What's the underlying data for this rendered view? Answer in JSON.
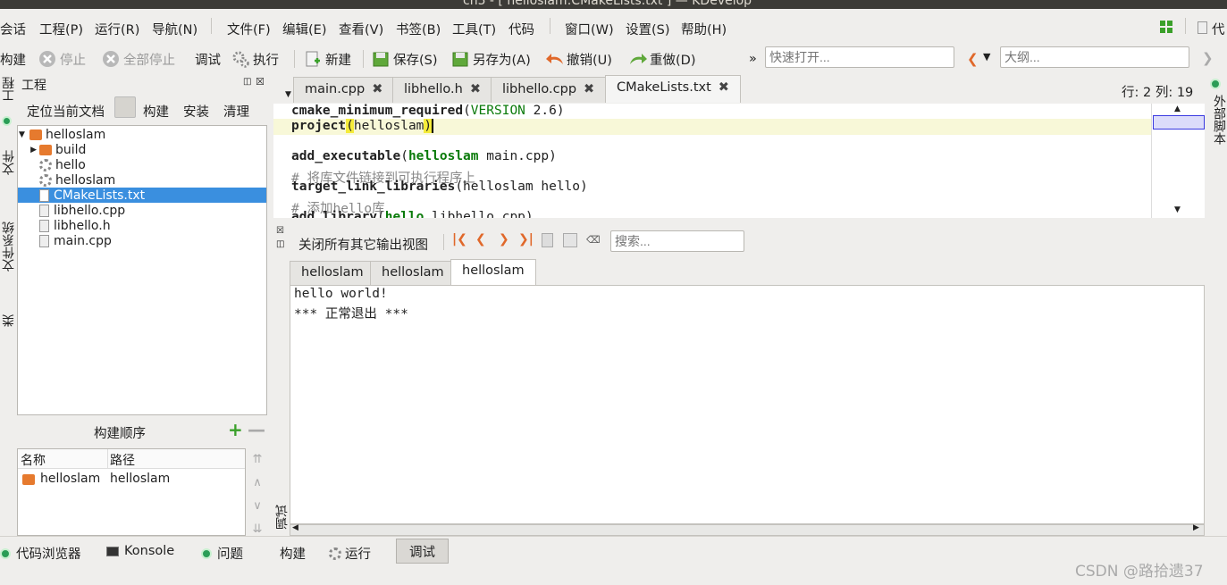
{
  "window": {
    "title": "ch5 - [ helloslam:CMakeLists.txt ] — KDevelop"
  },
  "menubar": {
    "items": [
      "会话",
      "工程(P)",
      "运行(R)",
      "导航(N)",
      "文件(F)",
      "编辑(E)",
      "查看(V)",
      "书签(B)",
      "工具(T)",
      "代码",
      "窗口(W)",
      "设置(S)",
      "帮助(H)"
    ],
    "right_label": "代"
  },
  "toolbar": {
    "build": "构建",
    "stop": "停止",
    "stop_all": "全部停止",
    "debug": "调试",
    "execute": "执行",
    "new": "新建",
    "save": "保存(S)",
    "save_as": "另存为(A)",
    "undo": "撤销(U)",
    "redo": "重做(D)",
    "more": "»",
    "quick_open_placeholder": "快速打开...",
    "outline_placeholder": "大纲..."
  },
  "left_tabs": [
    "工程",
    "文件",
    "文件系统",
    "类"
  ],
  "project_panel": {
    "title": "工程",
    "buttons": [
      "定位当前文档",
      "构建",
      "安装",
      "清理"
    ],
    "tree": [
      {
        "label": "helloslam",
        "icon": "folder-icon",
        "depth": 0
      },
      {
        "label": "build",
        "icon": "folder-icon",
        "depth": 1
      },
      {
        "label": "hello",
        "icon": "gear-icon",
        "depth": 1
      },
      {
        "label": "helloslam",
        "icon": "gear-icon",
        "depth": 1
      },
      {
        "label": "CMakeLists.txt",
        "icon": "file-icon",
        "depth": 1,
        "selected": true
      },
      {
        "label": "libhello.cpp",
        "icon": "file-icon",
        "depth": 1
      },
      {
        "label": "libhello.h",
        "icon": "file-icon",
        "depth": 1
      },
      {
        "label": "main.cpp",
        "icon": "file-icon",
        "depth": 1
      }
    ]
  },
  "build_order": {
    "title": "构建顺序",
    "columns": [
      "名称",
      "路径"
    ],
    "rows": [
      {
        "name": "helloslam",
        "path": "helloslam"
      }
    ]
  },
  "editor": {
    "tabs": [
      "main.cpp",
      "libhello.h",
      "libhello.cpp",
      "CMakeLists.txt"
    ],
    "active_tab": "CMakeLists.txt",
    "cursor_pos": "行: 2 列: 19",
    "lines": {
      "l1_fn": "cmake_minimum_required",
      "l1_arg": "VERSION",
      "l1_rest": " 2.6)",
      "l2_fn": "project",
      "l2_arg": "helloslam",
      "l4_fn": "add_executable",
      "l4_arg": "helloslam",
      "l4_rest": " main.cpp)",
      "l5_cmt": "# 将库文件链接到可执行程序上",
      "l6_fn": "target_link_libraries",
      "l6_rest": "(helloslam hello)",
      "l7_cmt": "# 添加hello库",
      "l8_fn": "add_library",
      "l8_arg": "hello",
      "l8_rest": " libhello.cpp)"
    }
  },
  "right_tab": "外部脚本",
  "output": {
    "close_all_label": "关闭所有其它输出视图",
    "search_placeholder": "搜索...",
    "tabs": [
      "helloslam",
      "helloslam",
      "helloslam"
    ],
    "lines": [
      "hello world!",
      "*** 正常退出 ***"
    ],
    "side_label": "调试"
  },
  "statusbar": {
    "items": [
      "代码浏览器",
      "Konsole",
      "问题",
      "构建",
      "运行",
      "调试"
    ],
    "active": "调试"
  },
  "watermark": "CSDN @路拾遗37",
  "colors": {
    "selection": "#3a8fdf",
    "folder": "#e67a2e",
    "keyword_green": "#0a7a0a",
    "titlebar": "#3c3b37"
  }
}
